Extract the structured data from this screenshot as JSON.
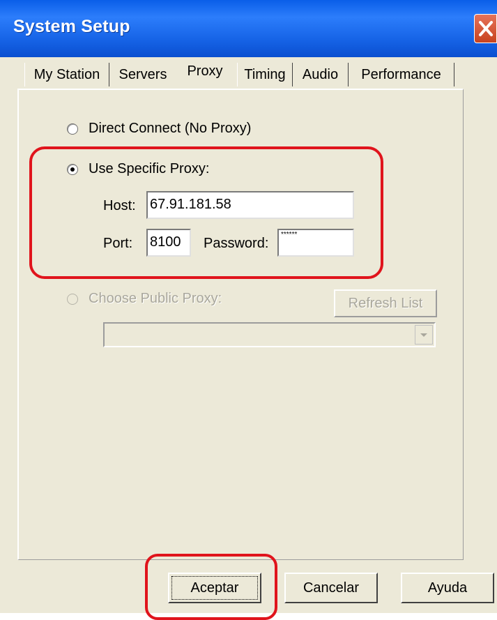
{
  "window": {
    "title": "System Setup"
  },
  "tabs": [
    {
      "label": "My Station"
    },
    {
      "label": "Servers"
    },
    {
      "label": "Proxy"
    },
    {
      "label": "Timing"
    },
    {
      "label": "Audio"
    },
    {
      "label": "Performance"
    }
  ],
  "proxy": {
    "direct_label": "Direct Connect (No Proxy)",
    "specific_label": "Use Specific Proxy:",
    "host_label": "Host:",
    "host_value": "67.91.181.58",
    "port_label": "Port:",
    "port_value": "8100",
    "password_label": "Password:",
    "password_value": "******",
    "public_label": "Choose Public Proxy:",
    "refresh_label": "Refresh List",
    "selected": "specific"
  },
  "buttons": {
    "ok": "Aceptar",
    "cancel": "Cancelar",
    "help": "Ayuda"
  },
  "colors": {
    "titlebar": "#0a5ee8",
    "annotation": "#e0141c",
    "background": "#ece9d8"
  }
}
